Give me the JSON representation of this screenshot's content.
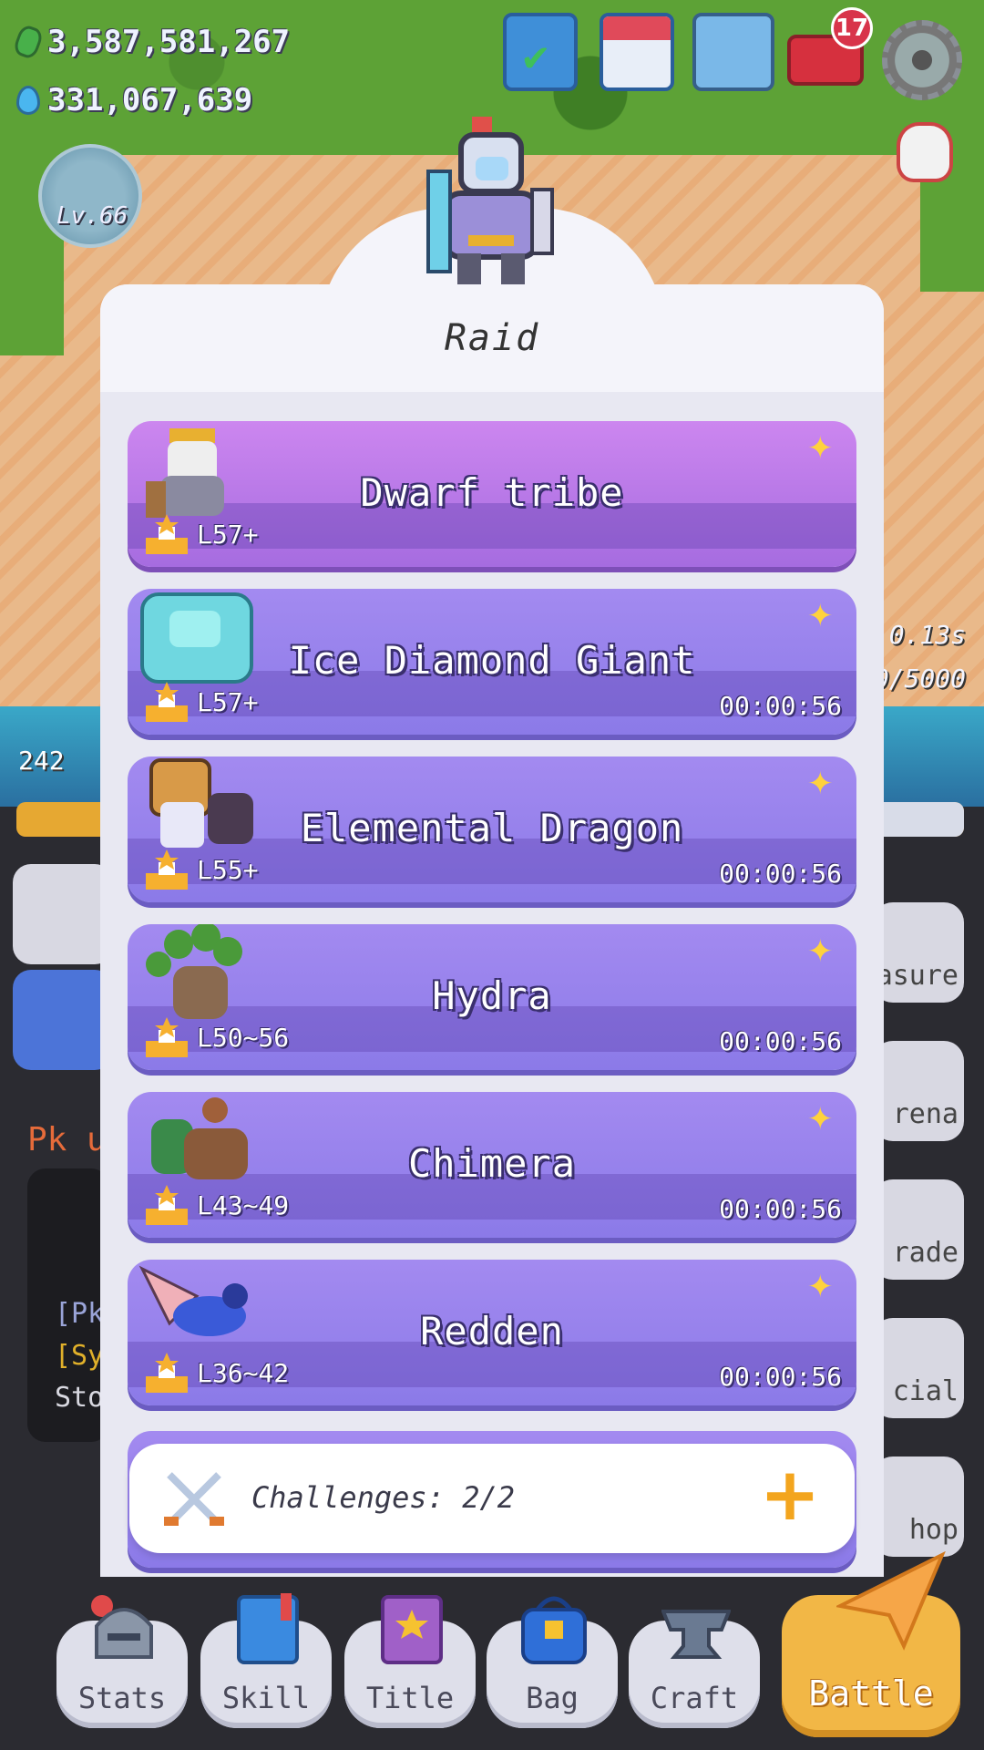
{
  "resources": {
    "gems": "3,587,581,267",
    "water": "331,067,639"
  },
  "player": {
    "level": "Lv.66"
  },
  "hud": {
    "mail_badge": "17",
    "left_count": "242",
    "side_timer": "0.13s",
    "side_progress": "0/5000",
    "side_labels": [
      "asure",
      "rena",
      "rade",
      "cial",
      "hop"
    ],
    "pk_text": "Pk u",
    "chat_lines": [
      "[Pk",
      "[Sy",
      "Sto"
    ]
  },
  "modal": {
    "title": "Raid",
    "raids": [
      {
        "name": "Dwarf tribe",
        "level": "L57+",
        "timer": ""
      },
      {
        "name": "Ice Diamond Giant",
        "level": "L57+",
        "timer": "00:00:56"
      },
      {
        "name": "Elemental Dragon",
        "level": "L55+",
        "timer": "00:00:56"
      },
      {
        "name": "Hydra",
        "level": "L50~56",
        "timer": "00:00:56"
      },
      {
        "name": "Chimera",
        "level": "L43~49",
        "timer": "00:00:56"
      },
      {
        "name": "Redden",
        "level": "L36~42",
        "timer": "00:00:56"
      }
    ],
    "challenges": "Challenges: 2/2"
  },
  "nav": {
    "stats": "Stats",
    "skill": "Skill",
    "title": "Title",
    "bag": "Bag",
    "craft": "Craft",
    "battle": "Battle"
  },
  "colors": {
    "card_purple": "#8b7ae8",
    "card_first": "#b176e6",
    "gold_accent": "#f3a51e",
    "battle_button": "#f2b746"
  },
  "icons": {
    "raid_sparkle": "sparkle-icon",
    "podium": "podium-icon",
    "challenge": "crossed-swords-icon",
    "add": "plus-icon"
  }
}
